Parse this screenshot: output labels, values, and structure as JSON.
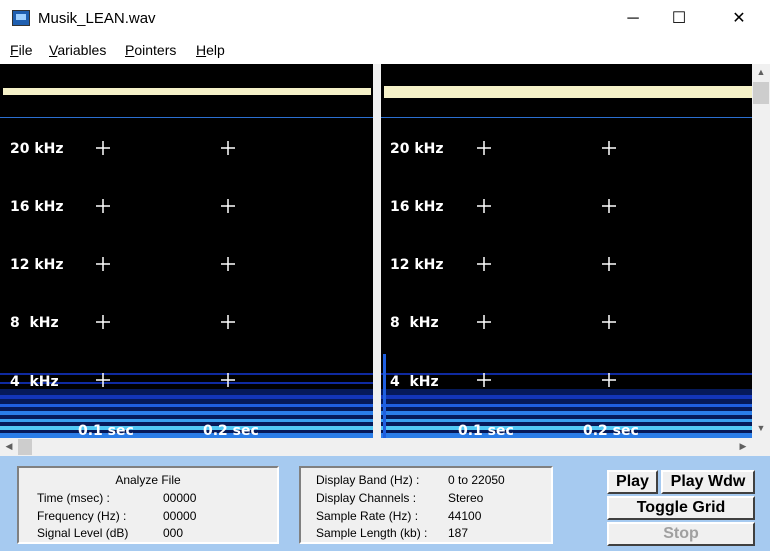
{
  "window": {
    "title": "Musik_LEAN.wav",
    "minimize": "─",
    "maximize": "☐",
    "close": "✕"
  },
  "menu": [
    {
      "accel": "F",
      "rest": "ile"
    },
    {
      "accel": "V",
      "rest": "ariables"
    },
    {
      "accel": "P",
      "rest": "ointers"
    },
    {
      "accel": "H",
      "rest": "elp"
    }
  ],
  "spectrogram": {
    "freq_labels": [
      "20 kHz",
      "16 kHz",
      "12 kHz",
      "8  kHz",
      "4  kHz"
    ],
    "time_labels": [
      "0.1 sec",
      "0.2 sec"
    ],
    "colors": {
      "background": "#000000",
      "waveform": "#f5f1c8",
      "divider": "#2b6fd1",
      "grid": "#ffffff"
    }
  },
  "analyze": {
    "title": "Analyze File",
    "rows": [
      {
        "label": "Time (msec) :",
        "value": "00000"
      },
      {
        "label": "Frequency (Hz) :",
        "value": "00000"
      },
      {
        "label": "Signal Level (dB)",
        "value": "000"
      }
    ]
  },
  "display": {
    "rows": [
      {
        "label": "Display Band (Hz) :",
        "value": "0 to 22050"
      },
      {
        "label": "Display Channels :",
        "value": "Stereo"
      },
      {
        "label": "Sample Rate (Hz) :",
        "value": "44100"
      },
      {
        "label": "Sample Length (kb) :",
        "value": "187"
      }
    ]
  },
  "buttons": {
    "play": "Play",
    "play_wdw": "Play Wdw",
    "toggle_grid": "Toggle Grid",
    "stop": "Stop"
  },
  "colors": {
    "bottom_panel": "#a6caf0"
  }
}
